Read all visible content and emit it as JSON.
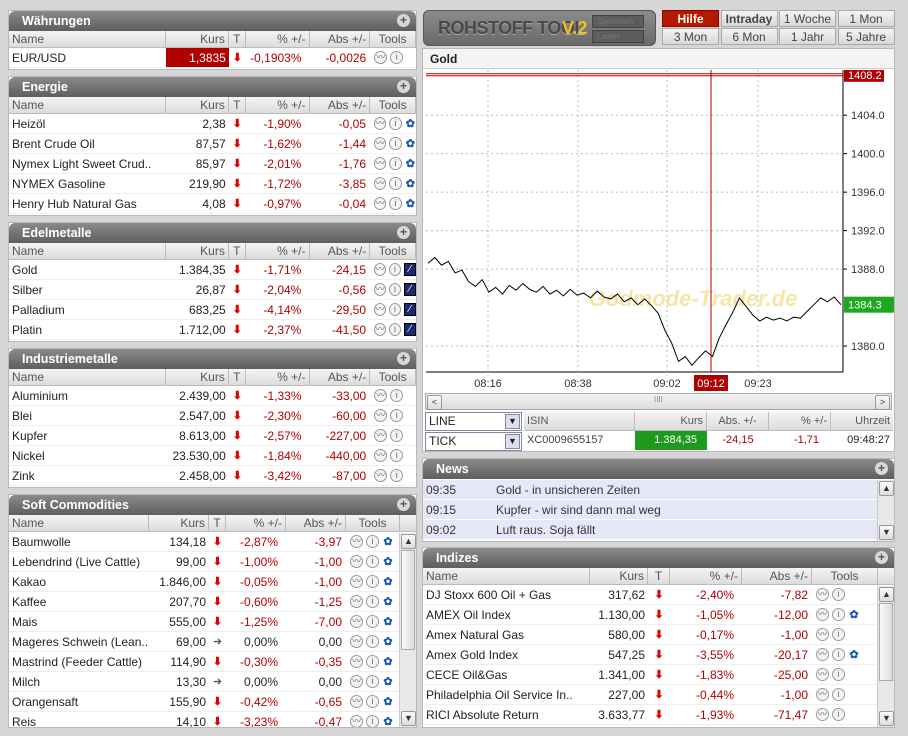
{
  "colors": {
    "accent_red": "#b00000",
    "positive_green": "#1f9a1f",
    "header_gray": "#6a6a6a"
  },
  "columns": {
    "name": "Name",
    "kurs": "Kurs",
    "t": "T",
    "pct": "% +/-",
    "abs": "Abs +/-",
    "tools": "Tools"
  },
  "panels": [
    {
      "title": "Währungen",
      "rows": [
        [
          "EUR/USD",
          "1,3835",
          "down",
          "-0,1903%",
          "-0,0026",
          "none"
        ]
      ]
    },
    {
      "title": "Energie",
      "rows": [
        [
          "Heizöl",
          "2,38",
          "down",
          "-1,90%",
          "-0,05",
          "gear"
        ],
        [
          "Brent Crude Oil",
          "87,57",
          "down",
          "-1,62%",
          "-1,44",
          "gear"
        ],
        [
          "Nymex Light Sweet Crud..",
          "85,97",
          "down",
          "-2,01%",
          "-1,76",
          "gear"
        ],
        [
          "NYMEX Gasoline",
          "219,90",
          "down",
          "-1,72%",
          "-3,85",
          "gear"
        ],
        [
          "Henry Hub Natural Gas",
          "4,08",
          "down",
          "-0,97%",
          "-0,04",
          "gear"
        ]
      ]
    },
    {
      "title": "Edelmetalle",
      "rows": [
        [
          "Gold",
          "1.384,35",
          "down",
          "-1,71%",
          "-24,15",
          "edit"
        ],
        [
          "Silber",
          "26,87",
          "down",
          "-2,04%",
          "-0,56",
          "edit"
        ],
        [
          "Palladium",
          "683,25",
          "down",
          "-4,14%",
          "-29,50",
          "edit"
        ],
        [
          "Platin",
          "1.712,00",
          "down",
          "-2,37%",
          "-41,50",
          "edit"
        ]
      ]
    },
    {
      "title": "Industriemetalle",
      "rows": [
        [
          "Aluminium",
          "2.439,00",
          "down",
          "-1,33%",
          "-33,00",
          "none"
        ],
        [
          "Blei",
          "2.547,00",
          "down",
          "-2,30%",
          "-60,00",
          "none"
        ],
        [
          "Kupfer",
          "8.613,00",
          "down",
          "-2,57%",
          "-227,00",
          "none"
        ],
        [
          "Nickel",
          "23.530,00",
          "down",
          "-1,84%",
          "-440,00",
          "none"
        ],
        [
          "Zink",
          "2.458,00",
          "down",
          "-3,42%",
          "-87,00",
          "none"
        ]
      ]
    },
    {
      "title": "Soft Commodities",
      "rows": [
        [
          "Baumwolle",
          "134,18",
          "down",
          "-2,87%",
          "-3,97",
          "gear"
        ],
        [
          "Lebendrind (Live Cattle)",
          "99,00",
          "down",
          "-1,00%",
          "-1,00",
          "gear"
        ],
        [
          "Kakao",
          "1.846,00",
          "down",
          "-0,05%",
          "-1,00",
          "gear"
        ],
        [
          "Kaffee",
          "207,70",
          "down",
          "-0,60%",
          "-1,25",
          "gear"
        ],
        [
          "Mais",
          "555,00",
          "down",
          "-1,25%",
          "-7,00",
          "gear"
        ],
        [
          "Mageres Schwein (Lean..",
          "69,00",
          "flat",
          "0,00%",
          "0,00",
          "gear"
        ],
        [
          "Mastrind (Feeder Cattle)",
          "114,90",
          "down",
          "-0,30%",
          "-0,35",
          "gear"
        ],
        [
          "Milch",
          "13,30",
          "flat",
          "0,00%",
          "0,00",
          "gear"
        ],
        [
          "Orangensaft",
          "155,90",
          "down",
          "-0,42%",
          "-0,65",
          "gear"
        ],
        [
          "Reis",
          "14,10",
          "down",
          "-3,23%",
          "-0,47",
          "gear"
        ]
      ]
    },
    {
      "title": "Indizes",
      "rows": [
        [
          "DJ Stoxx 600 Oil + Gas",
          "317,62",
          "down",
          "-2,40%",
          "-7,82",
          "none"
        ],
        [
          "AMEX Oil Index",
          "1.130,00",
          "down",
          "-1,05%",
          "-12,00",
          "gear"
        ],
        [
          "Amex Natural Gas",
          "580,00",
          "down",
          "-0,17%",
          "-1,00",
          "none"
        ],
        [
          "Amex Gold Index",
          "547,25",
          "down",
          "-3,55%",
          "-20,17",
          "gear"
        ],
        [
          "CECE Oil&Gas",
          "1.341,00",
          "down",
          "-1,83%",
          "-25,00",
          "none"
        ],
        [
          "Philadelphia Oil Service In..",
          "227,00",
          "down",
          "-0,44%",
          "-1,00",
          "none"
        ],
        [
          "RICI Absolute Return",
          "3.633,77",
          "down",
          "-1,93%",
          "-71,47",
          "none"
        ]
      ]
    }
  ],
  "logo": {
    "text": "ROHSTOFF TOOL",
    "version": "V.2",
    "btn_save": "Speichern",
    "btn_load": "Laden"
  },
  "timeframes": [
    "Hilfe",
    "Intraday",
    "1 Woche",
    "1 Mon",
    "3 Mon",
    "6 Mon",
    "1 Jahr",
    "5 Jahre"
  ],
  "chart_header": "Gold",
  "watermark": "Godmode-Trader.de",
  "chart_data": {
    "type": "line",
    "title": "Gold",
    "y_ticks": [
      "1404.0",
      "1400.0",
      "1396.0",
      "1392.0",
      "1388.0",
      "1380.0"
    ],
    "y_tick_values": [
      1404,
      1400,
      1396,
      1392,
      1388,
      1380
    ],
    "ylim": [
      1377.3,
      1408.7
    ],
    "x_ticks": [
      "08:16",
      "08:38",
      "09:02",
      "09:23"
    ],
    "cursor_time": "09:12",
    "high_label": "1408.2",
    "high_value": 1408.2,
    "last_label": "1384.3",
    "last_value": 1384.3,
    "values": [
      1388.6,
      1389.2,
      1388.4,
      1388.8,
      1387.6,
      1387.9,
      1386.7,
      1386.2,
      1386.9,
      1385.6,
      1386.1,
      1385.4,
      1386.3,
      1385.8,
      1386.5,
      1385.9,
      1385.6,
      1386.2,
      1385.4,
      1385.8,
      1385.2,
      1385.9,
      1385.3,
      1385.5,
      1385.0,
      1385.7,
      1385.1,
      1384.9,
      1385.4,
      1384.6,
      1385.0,
      1384.3,
      1384.9,
      1384.2,
      1383.4,
      1381.6,
      1380.3,
      1378.4,
      1378.9,
      1378.0,
      1378.8,
      1379.5,
      1378.9,
      1380.8,
      1382.2,
      1383.5,
      1385.0,
      1384.1,
      1383.2,
      1382.6,
      1383.0,
      1382.7,
      1382.9,
      1382.6,
      1383.0,
      1382.9,
      1383.6,
      1384.3,
      1385.0,
      1384.6,
      1385.1,
      1384.3
    ]
  },
  "scroll_grip": "IIII",
  "selects": {
    "type": "LINE",
    "resolution": "TICK"
  },
  "quote": {
    "headers": [
      "ISIN",
      "Kurs",
      "Abs. +/-",
      "% +/-",
      "Uhrzeit"
    ],
    "isin": "XC0009655157",
    "kurs": "1.384,35",
    "abs": "-24,15",
    "pct": "-1,71",
    "time": "09:48:27"
  },
  "news": {
    "title": "News",
    "items": [
      [
        "09:35",
        "Gold - in unsicheren Zeiten"
      ],
      [
        "09:15",
        "Kupfer  - wir sind dann mal weg"
      ],
      [
        "09:02",
        "Luft raus. Soja fällt"
      ]
    ]
  }
}
